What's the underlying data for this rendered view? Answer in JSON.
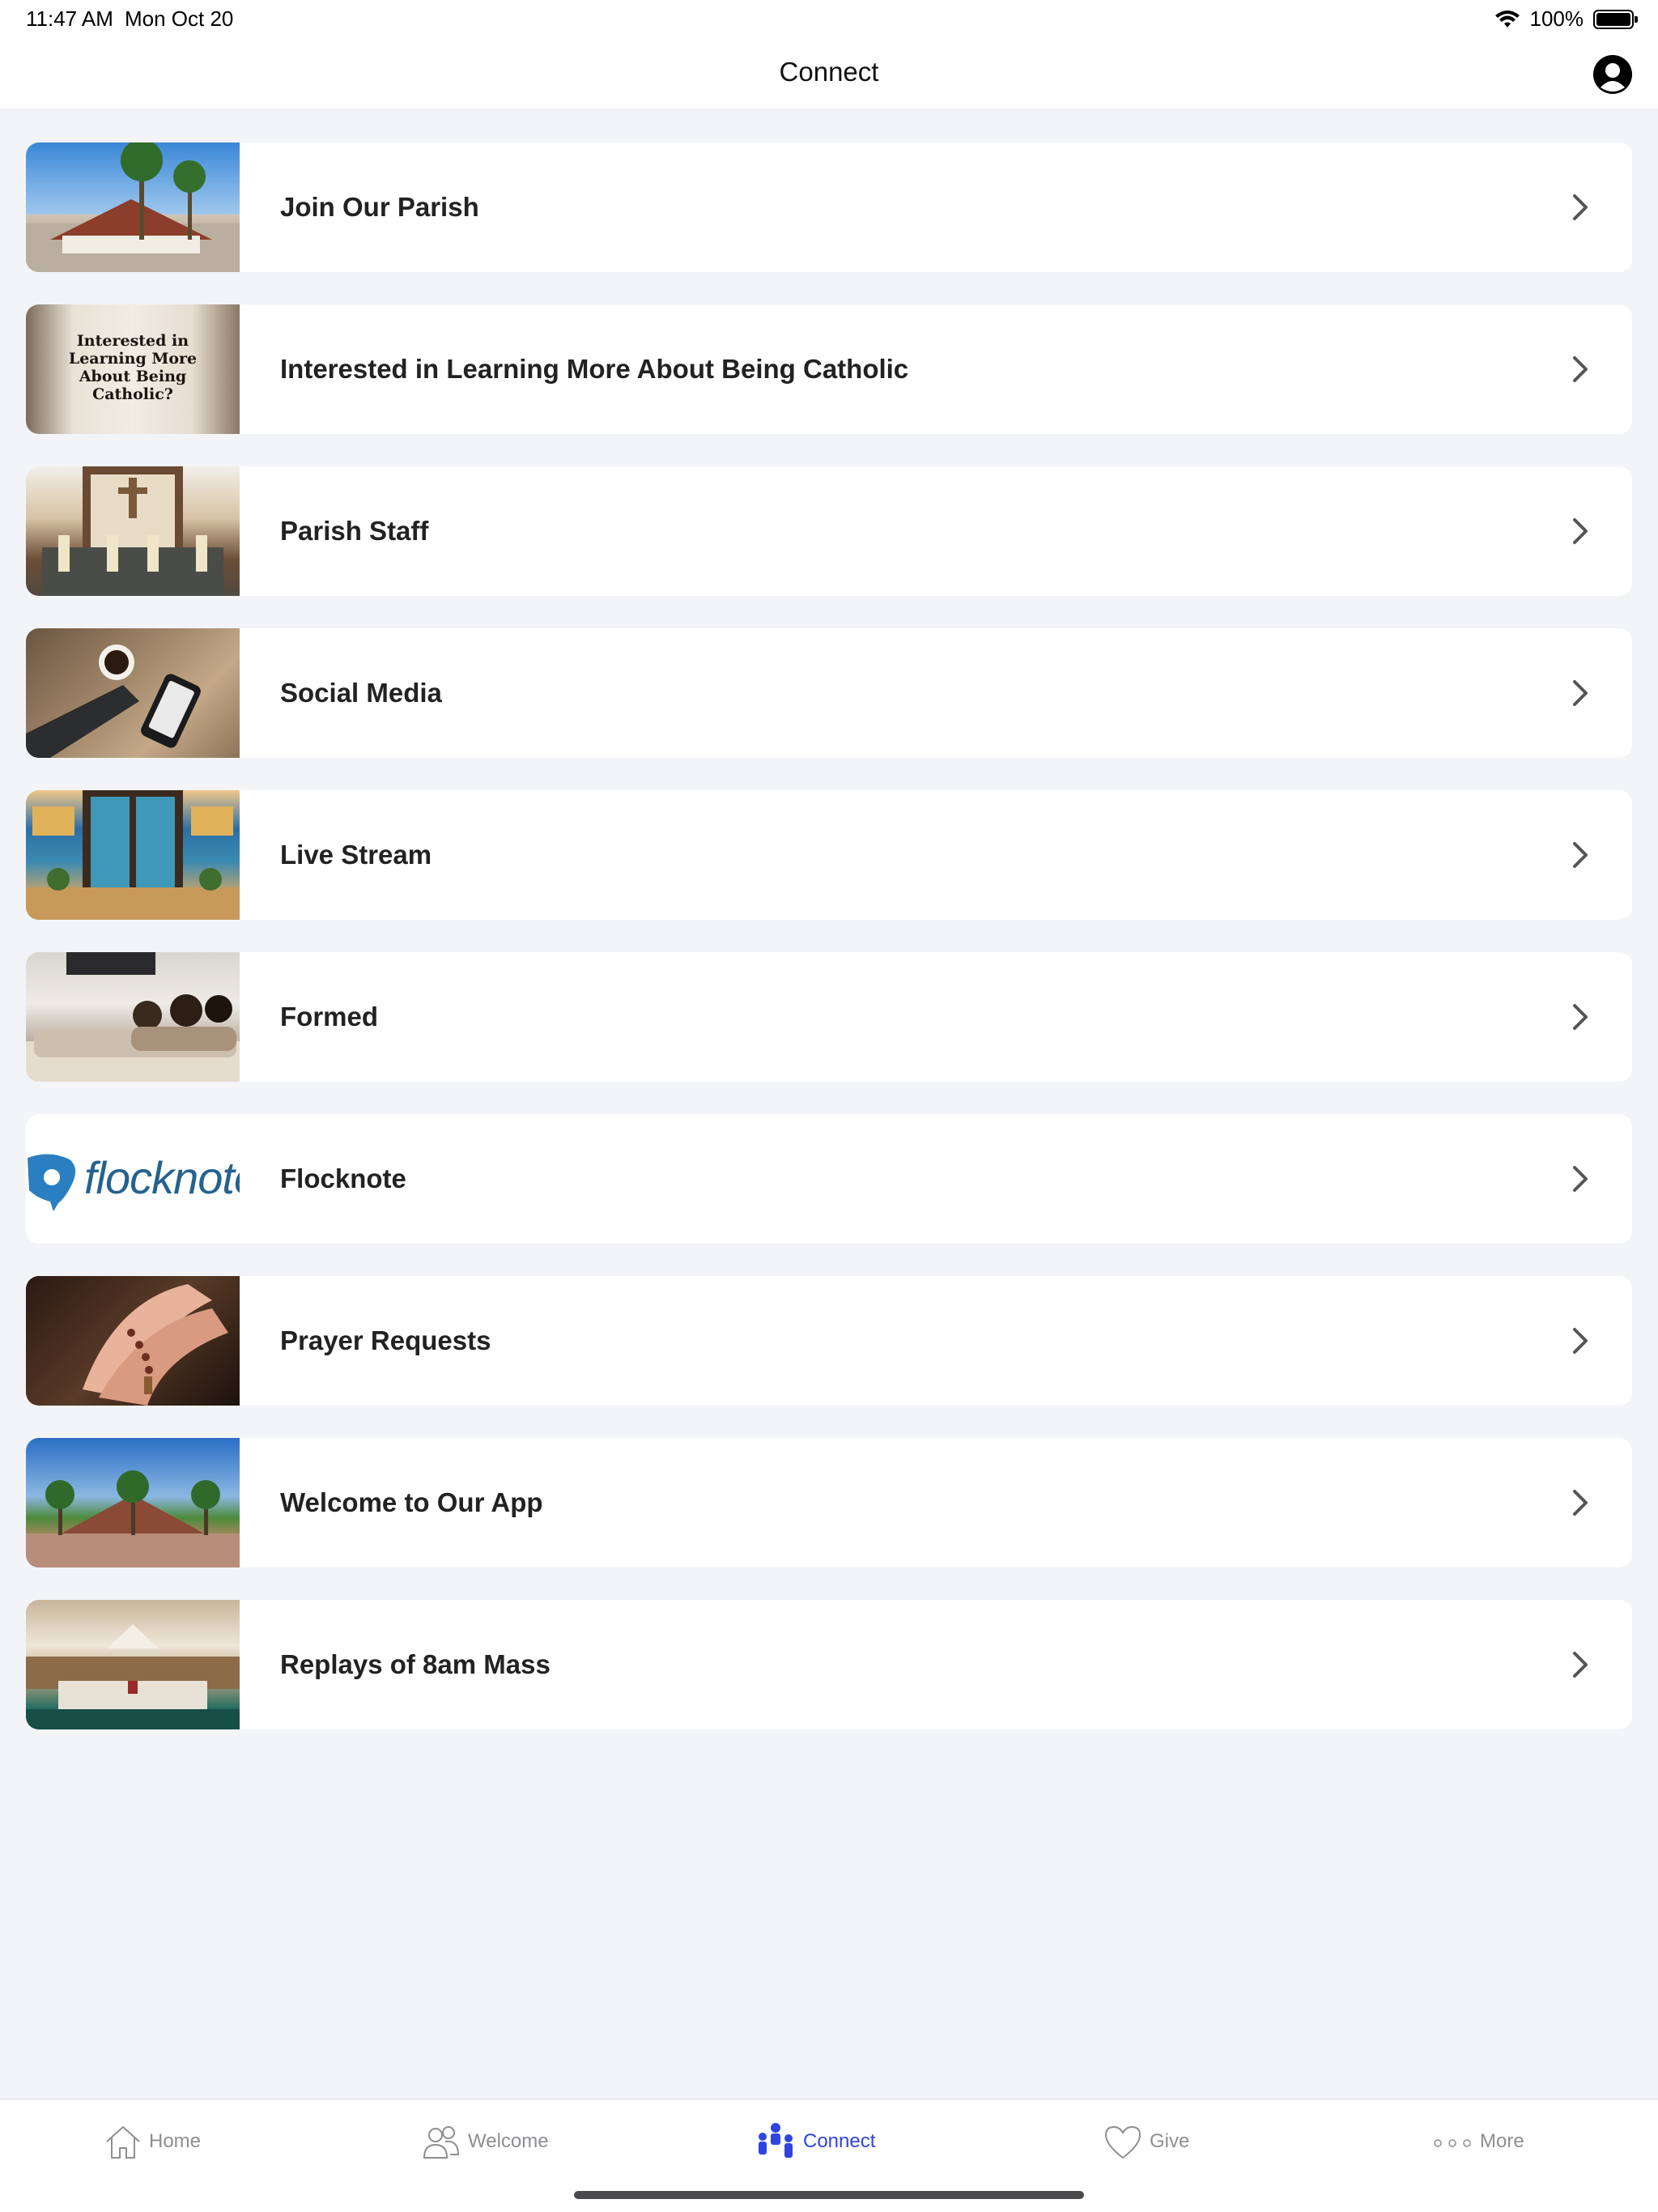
{
  "status_bar": {
    "time": "11:47 AM",
    "date": "Mon Oct 20",
    "battery_percent": "100%"
  },
  "nav": {
    "title": "Connect"
  },
  "items": [
    {
      "label": "Join Our Parish"
    },
    {
      "label": "Interested in Learning More About Being Catholic",
      "thumb_text": "Interested in Learning More About Being Catholic?"
    },
    {
      "label": "Parish Staff"
    },
    {
      "label": "Social Media"
    },
    {
      "label": "Live Stream"
    },
    {
      "label": "Formed"
    },
    {
      "label": "Flocknote",
      "thumb_text": "flocknote"
    },
    {
      "label": "Prayer Requests"
    },
    {
      "label": "Welcome to Our App"
    },
    {
      "label": "Replays of 8am Mass"
    }
  ],
  "tabs": [
    {
      "label": "Home",
      "icon": "home-icon"
    },
    {
      "label": "Welcome",
      "icon": "people-icon"
    },
    {
      "label": "Connect",
      "icon": "connect-icon",
      "active": true
    },
    {
      "label": "Give",
      "icon": "heart-icon"
    },
    {
      "label": "More",
      "icon": "more-dots-icon"
    }
  ],
  "colors": {
    "accent": "#2f44e0",
    "background": "#f3f4f8",
    "card": "#ffffff",
    "flocknote_blue": "#2a7fc2"
  }
}
